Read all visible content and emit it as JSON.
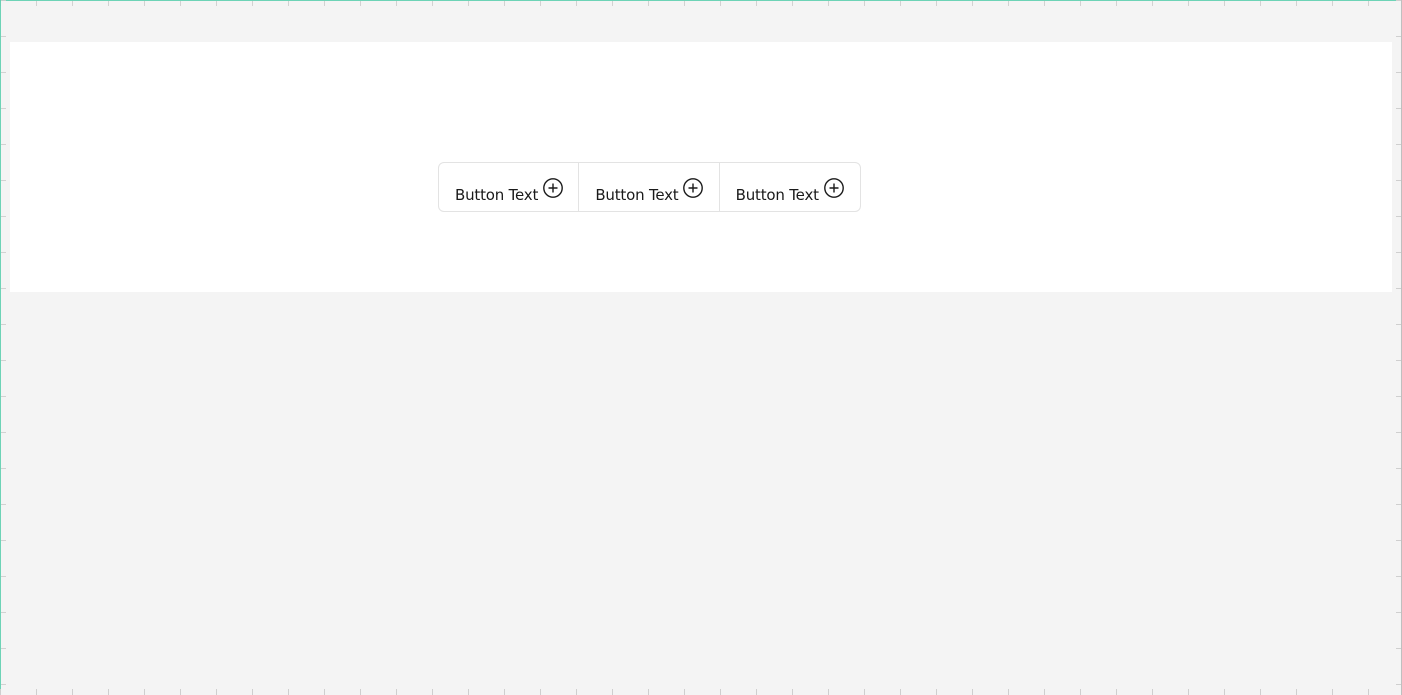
{
  "button_group": {
    "buttons": [
      {
        "label": "Button Text",
        "icon": "add-circle-icon"
      },
      {
        "label": "Button Text",
        "icon": "add-circle-icon"
      },
      {
        "label": "Button Text",
        "icon": "add-circle-icon"
      }
    ]
  },
  "colors": {
    "canvas": "#f4f4f4",
    "artboard": "#ffffff",
    "border": "#e3e3e3",
    "text": "#1a1a1a",
    "guide_accent": "#5fd0b0"
  }
}
